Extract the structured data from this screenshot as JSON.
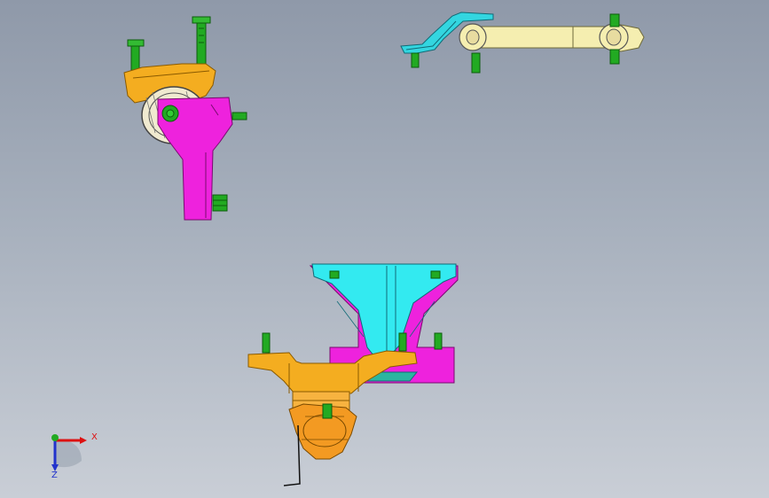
{
  "viewport": {
    "background_top": "#8f99a9",
    "background_bottom": "#c9ced6"
  },
  "parts": [
    {
      "name": "left-engine-mount",
      "colors": [
        "#f4ad20",
        "#ee22dd",
        "#22aa22"
      ]
    },
    {
      "name": "torque-rod",
      "colors": [
        "#f5eeb0",
        "#33d6e0",
        "#22aa22"
      ]
    },
    {
      "name": "transmission-mount-assembly",
      "colors": [
        "#33eaf0",
        "#ee22dd",
        "#f4ad20",
        "#f39a22",
        "#22aa22"
      ]
    }
  ],
  "triad": {
    "x_label": "X",
    "z_label": "Z",
    "x_color": "#dd1111",
    "y_color": "#22aa22",
    "z_color": "#2233cc"
  }
}
